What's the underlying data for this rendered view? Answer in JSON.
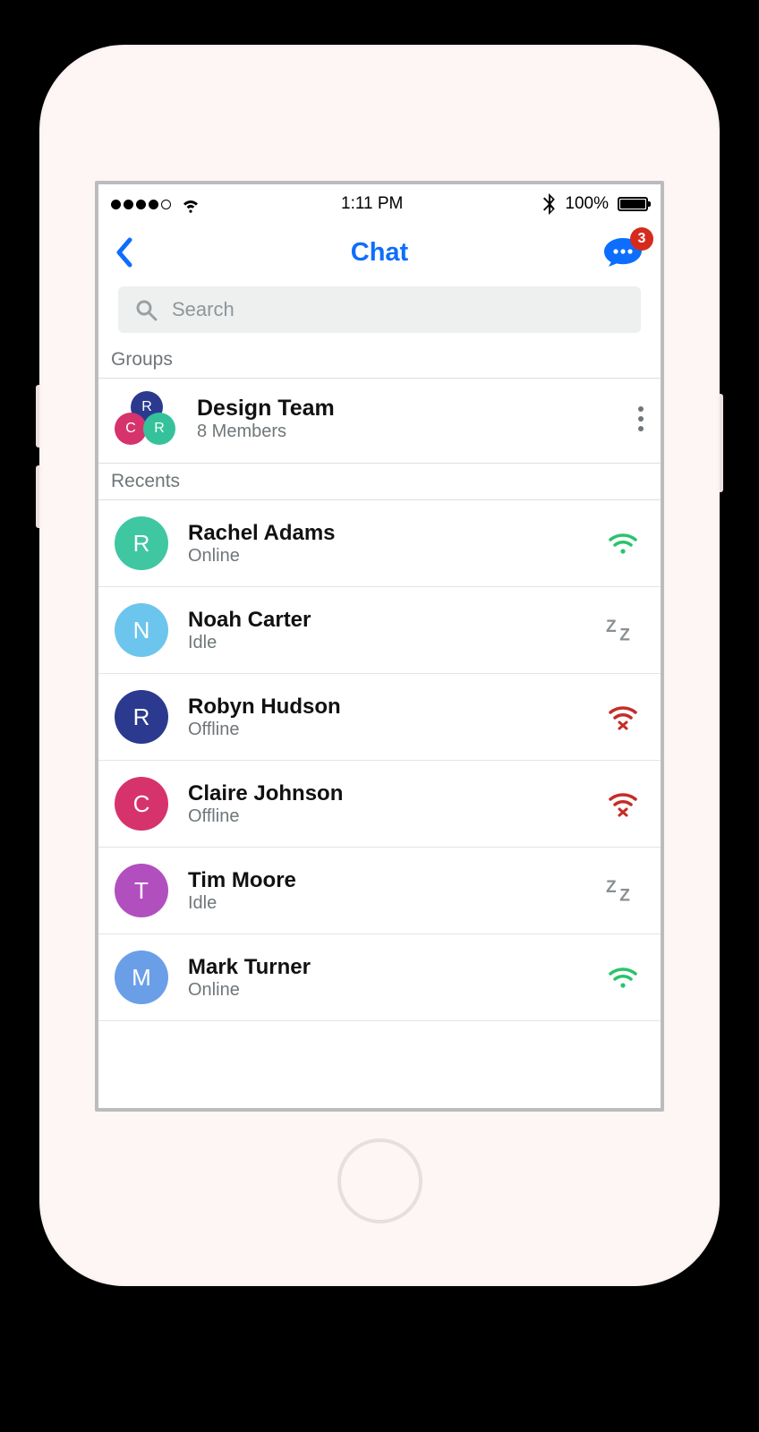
{
  "status_bar": {
    "time": "1:11 PM",
    "battery_pct": "100%"
  },
  "nav": {
    "title": "Chat",
    "notifications_badge": "3"
  },
  "search": {
    "placeholder": "Search"
  },
  "sections": {
    "groups_label": "Groups",
    "recents_label": "Recents"
  },
  "group": {
    "name": "Design Team",
    "members_line": "8 Members",
    "avatar_letters": [
      "R",
      "C",
      "R"
    ],
    "avatar_colors": [
      "#2b3a8f",
      "#d6336c",
      "#35c29a"
    ]
  },
  "contacts": [
    {
      "name": "Rachel Adams",
      "status": "Online",
      "status_kind": "online",
      "initial": "R",
      "color": "#3fc7a1"
    },
    {
      "name": "Noah Carter",
      "status": "Idle",
      "status_kind": "idle",
      "initial": "N",
      "color": "#6cc5ec"
    },
    {
      "name": "Robyn Hudson",
      "status": "Offline",
      "status_kind": "offline",
      "initial": "R",
      "color": "#2b3a8f"
    },
    {
      "name": "Claire Johnson",
      "status": "Offline",
      "status_kind": "offline",
      "initial": "C",
      "color": "#d6336c"
    },
    {
      "name": "Tim Moore",
      "status": "Idle",
      "status_kind": "idle",
      "initial": "T",
      "color": "#b24fbf"
    },
    {
      "name": "Mark Turner",
      "status": "Online",
      "status_kind": "online",
      "initial": "M",
      "color": "#6a9fe8"
    }
  ],
  "colors": {
    "accent_blue": "#0d6efd",
    "online_green": "#29c46b",
    "offline_red": "#c62c27",
    "idle_gray": "#8a8f92"
  }
}
